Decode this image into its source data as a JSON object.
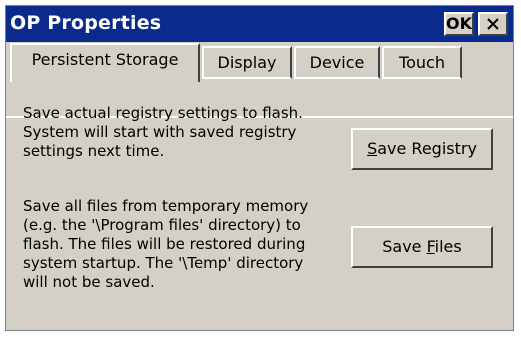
{
  "window": {
    "title": "OP Properties",
    "ok_label": "OK",
    "close_icon": "close-icon"
  },
  "tabs": [
    {
      "label": "Persistent Storage",
      "active": true
    },
    {
      "label": "Display",
      "active": false
    },
    {
      "label": "Device",
      "active": false
    },
    {
      "label": "Touch",
      "active": false
    }
  ],
  "registry": {
    "description": "Save actual registry settings to flash.\nSystem will start with saved registry\nsettings next time.",
    "button_prefix": "",
    "button_accel": "S",
    "button_suffix": "ave Registry"
  },
  "files": {
    "description": "Save all files from temporary memory\n(e.g. the '\\Program files' directory) to\nflash. The files will be restored during\nsystem startup. The '\\Temp' directory\nwill not be saved.",
    "button_prefix": "Save ",
    "button_accel": "F",
    "button_suffix": "iles"
  },
  "colors": {
    "titlebar": "#0a2a8c",
    "face": "#d4d0c8"
  }
}
